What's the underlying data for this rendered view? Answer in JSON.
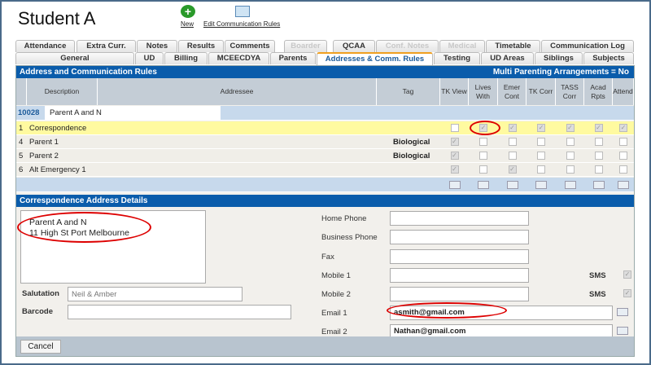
{
  "header": {
    "title": "Student A",
    "new_label": "New",
    "edit_label": "Edit Communication Rules"
  },
  "tabs_row1": [
    {
      "label": "Attendance"
    },
    {
      "label": "Extra Curr."
    },
    {
      "label": "Notes"
    },
    {
      "label": "Results"
    },
    {
      "label": "Comments"
    },
    {
      "label": "Boarder",
      "disabled": true
    },
    {
      "label": "QCAA"
    },
    {
      "label": "Conf. Notes",
      "disabled": true
    },
    {
      "label": "Medical",
      "disabled": true
    },
    {
      "label": "Timetable"
    },
    {
      "label": "Communication Log"
    }
  ],
  "tabs_row2": [
    {
      "label": "General"
    },
    {
      "label": "UD"
    },
    {
      "label": "Billing"
    },
    {
      "label": "MCEECDYA"
    },
    {
      "label": "Parents"
    },
    {
      "label": "Addresses & Comm. Rules",
      "active": true
    },
    {
      "label": "Testing"
    },
    {
      "label": "UD Areas"
    },
    {
      "label": "Siblings"
    },
    {
      "label": "Subjects"
    }
  ],
  "rules": {
    "title": "Address and Communication Rules",
    "multi_parenting": "Multi Parenting Arrangements = No",
    "columns": [
      "Description",
      "Addressee",
      "Tag",
      "TK View",
      "Lives With",
      "Emer Cont",
      "TK Corr",
      "TASS Corr",
      "Acad Rpts",
      "Attend"
    ],
    "group": {
      "id": "10028",
      "name": "Parent A and N"
    },
    "rows": [
      {
        "num": "1",
        "desc": "Correspondence",
        "tag": "",
        "checks": [
          false,
          true,
          true,
          true,
          true,
          true,
          true
        ]
      },
      {
        "num": "4",
        "desc": "Parent 1",
        "tag": "Biological",
        "checks": [
          true,
          false,
          false,
          false,
          false,
          false,
          false
        ]
      },
      {
        "num": "5",
        "desc": "Parent 2",
        "tag": "Biological",
        "checks": [
          true,
          false,
          false,
          false,
          false,
          false,
          false
        ]
      },
      {
        "num": "6",
        "desc": "Alt Emergency 1",
        "tag": "",
        "checks": [
          true,
          false,
          true,
          false,
          false,
          false,
          false
        ]
      }
    ]
  },
  "details": {
    "title": "Correspondence Address Details",
    "address_line1": "Parent A and N",
    "address_line2": "11 High St Port Melbourne",
    "salutation_label": "Salutation",
    "salutation_placeholder": "Neil & Amber",
    "barcode_label": "Barcode",
    "home_phone": "Home Phone",
    "business_phone": "Business Phone",
    "fax": "Fax",
    "mobile1": "Mobile 1",
    "mobile2": "Mobile 2",
    "sms": "SMS",
    "email1_label": "Email 1",
    "email1": "asmith@gmail.com",
    "email2_label": "Email 2",
    "email2": "Nathan@gmail.com"
  },
  "footer": {
    "cancel": "Cancel"
  },
  "colors": {
    "header_blue": "#0a5cab",
    "highlight": "#fffaa0",
    "annotation": "#dd0000"
  }
}
